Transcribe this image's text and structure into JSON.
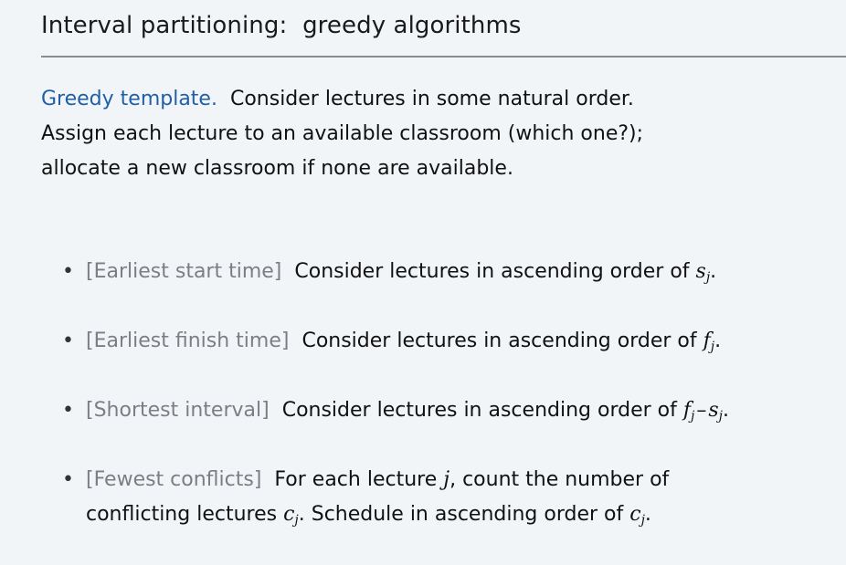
{
  "slide": {
    "title": "Interval partitioning:  greedy algorithms"
  },
  "intro": {
    "label": "Greedy template.",
    "line1": "Consider lectures in some natural order.",
    "line2": "Assign each lecture to an available classroom (which one?);",
    "line3": "allocate a new classroom if none are available."
  },
  "bullets": [
    {
      "tag": "[Earliest start time]",
      "text": "Consider lectures in ascending order of",
      "var": "s",
      "sub": "j",
      "end": "."
    },
    {
      "tag": "[Earliest finish time]",
      "text": "Consider lectures in ascending order of",
      "var": "f",
      "sub": "j",
      "end": "."
    },
    {
      "tag": "[Shortest interval]",
      "text": "Consider lectures in ascending order of",
      "var1": "f",
      "sub1": "j",
      "op": "–",
      "var2": "s",
      "sub2": "j",
      "end": "."
    },
    {
      "tag": "[Fewest conflicts]",
      "text1": "For each lecture",
      "var_j": "j",
      "text2": ", count the number of",
      "text3": "conflicting lectures",
      "var_c1": "c",
      "sub_c1": "j",
      "text4": ". Schedule in ascending order of",
      "var_c2": "c",
      "sub_c2": "j",
      "end": "."
    }
  ],
  "colors": {
    "background": "#f2f5f8",
    "accent": "#1f5fa8",
    "tag": "#7b7f85",
    "rule": "#8c8c8c"
  }
}
